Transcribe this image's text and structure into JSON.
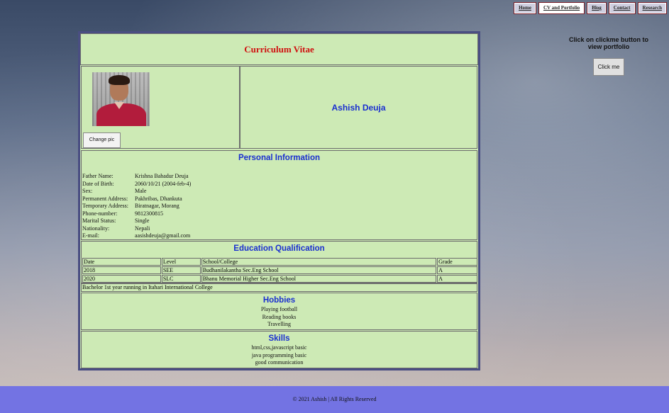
{
  "nav": [
    "Home",
    "CV and Portfolio",
    "Blog",
    "Contact",
    "Research"
  ],
  "side": {
    "message": "Click on clickme button to view portfolio",
    "button": "Click me"
  },
  "cv": {
    "title": "Curriculum Vitae",
    "name": "Ashish Deuja",
    "change_pic": "Change pic",
    "personal": {
      "heading": "Personal Information",
      "rows": [
        {
          "k": "Father Name:",
          "v": "Krishna Bahadur Deuja"
        },
        {
          "k": "Date of Birth:",
          "v": "2060/10/21 (2004-feb-4)"
        },
        {
          "k": "Sex:",
          "v": "Male"
        },
        {
          "k": "Permanent Address:",
          "v": "Pakhribas, Dhankuta"
        },
        {
          "k": "Temporary Address:",
          "v": "Biratnagar, Morang"
        },
        {
          "k": "Phone-number:",
          "v": "9812300815"
        },
        {
          "k": "Marital Status:",
          "v": "Single"
        },
        {
          "k": "Nationality:",
          "v": "Nepali"
        },
        {
          "k": "E-mail:",
          "v": "aasishdeuja@gmail.com"
        }
      ]
    },
    "education": {
      "heading": "Education Qualification",
      "headers": [
        "Date",
        "Level",
        "School/College",
        "Grade"
      ],
      "rows": [
        [
          "2018",
          "SEE",
          "Budhanilakantha Sec.Eng School",
          "A"
        ],
        [
          "2020",
          "SLC",
          "Bhanu Memorial Higher Sec.Eng School",
          "A"
        ]
      ],
      "note": "Bachelor 1st year running in Itahari International College"
    },
    "hobbies": {
      "heading": "Hobbies",
      "items": [
        "Playing football",
        "Reading books",
        "Travelling"
      ]
    },
    "skills": {
      "heading": "Skills",
      "items": [
        "html,css,javascript basic",
        "java programming basic",
        "good communication"
      ]
    }
  },
  "footer": "© 2021 Ashish | All Rights Reserved"
}
